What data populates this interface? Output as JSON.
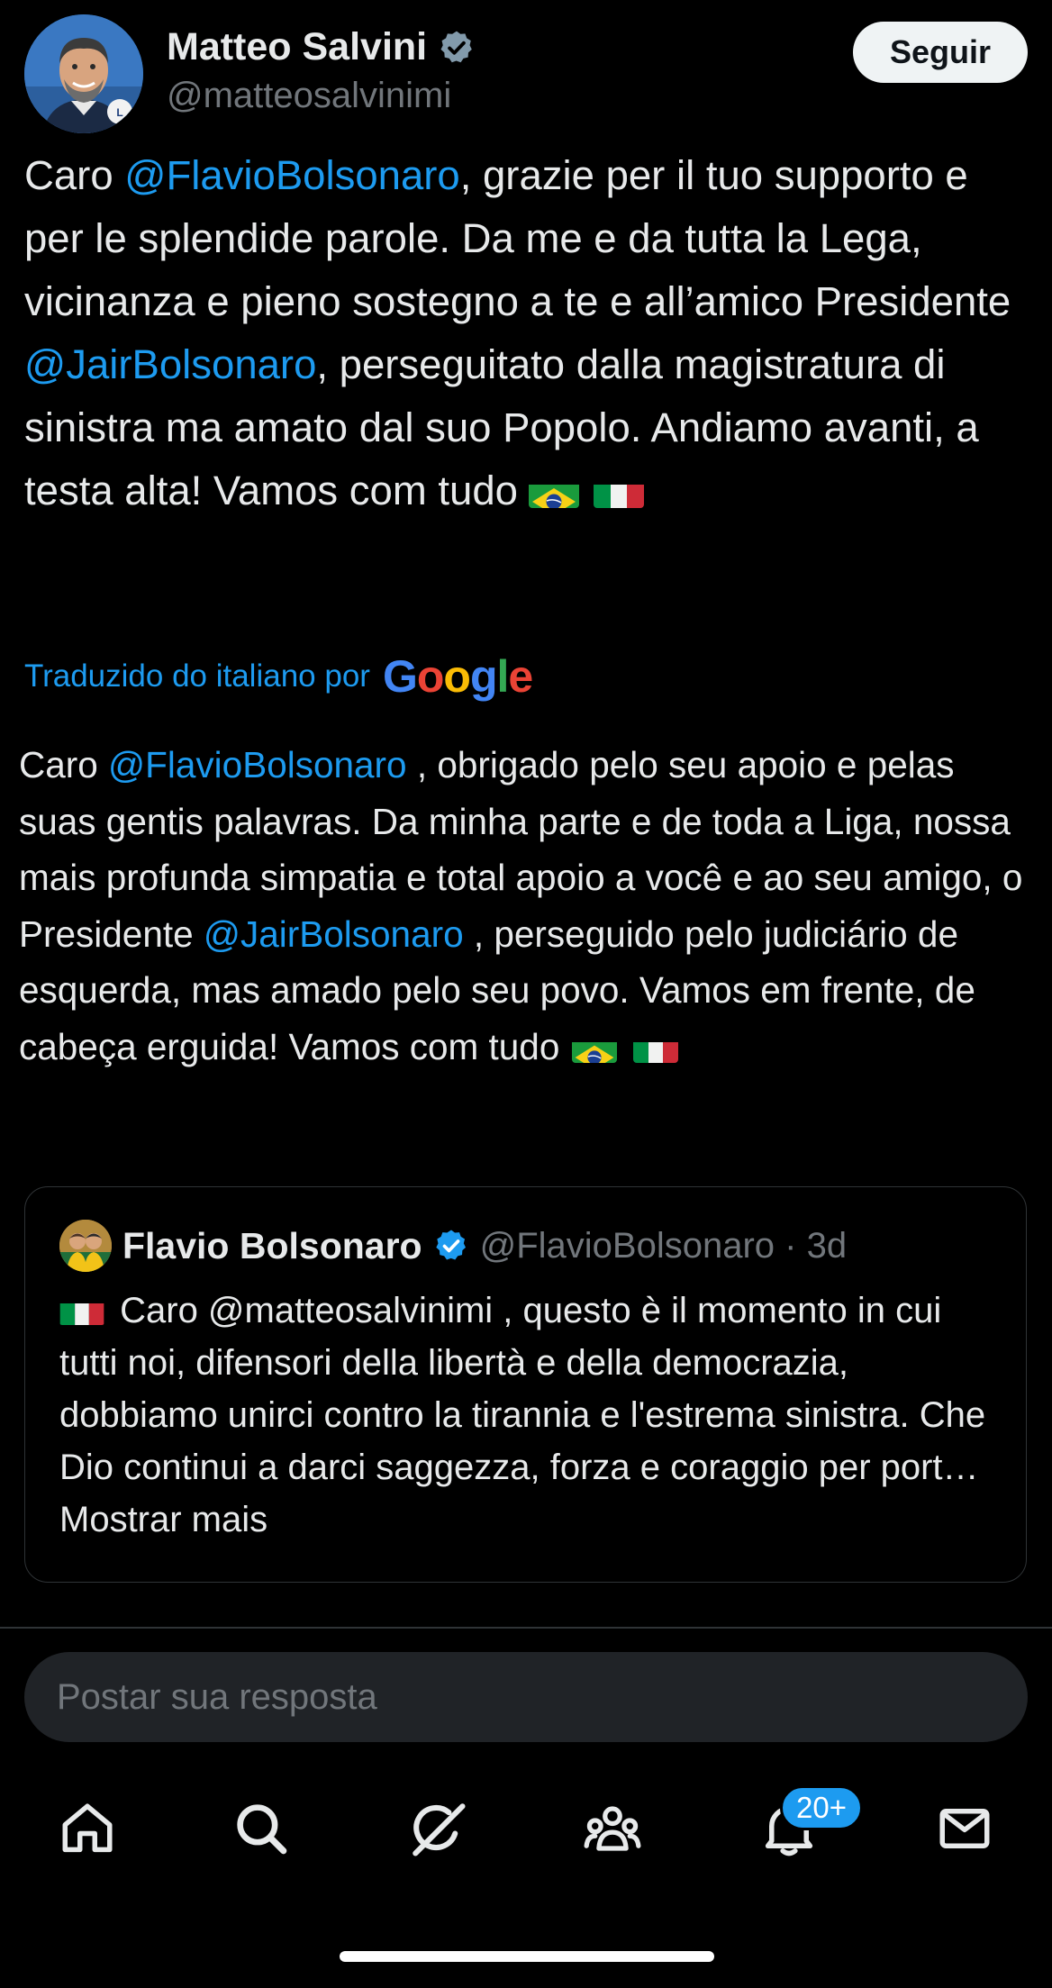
{
  "author": {
    "name": "Matteo Salvini",
    "handle": "@matteosalvinimi",
    "avatar_icon": "person-avatar"
  },
  "follow_button": {
    "label": "Seguir"
  },
  "tweet": {
    "segments": {
      "s1": "Caro ",
      "m1": "@FlavioBolsonaro",
      "s2": ", grazie per il tuo supporto e per le splendide parole. Da me e da tutta la Lega, vicinanza e pieno sostegno a te e all’amico Presidente ",
      "m2": "@JairBolsonaro",
      "s3": ", perseguitato dalla magistratura di sinistra ma amato dal suo Popolo. Andiamo avanti, a testa alta! Vamos com tudo"
    },
    "flags": [
      "brazil-flag",
      "italy-flag"
    ]
  },
  "translation": {
    "label": "Traduzido do italiano por",
    "provider": "Google",
    "segments": {
      "s1": "Caro ",
      "m1": "@FlavioBolsonaro",
      "s2": " , obrigado pelo seu apoio e pelas suas gentis palavras. Da minha parte e de toda a Liga, nossa mais profunda simpatia e total apoio a você e ao seu amigo, o Presidente ",
      "m2": "@JairBolsonaro",
      "s3": " , perseguido pelo judiciário de esquerda, mas amado pelo seu povo. Vamos em frente, de cabeça erguida! Vamos com tudo"
    }
  },
  "quoted_tweet": {
    "name": "Flavio Bolsonaro",
    "handle_time": "@FlavioBolsonaro · 3d",
    "text": " Caro @matteosalvinimi , questo è il momento in cui tutti noi, difensori della libertà e della democrazia, dobbiamo unirci contro la tirannia e l'estrema sinistra. Che Dio continui a darci saggezza, forza e coraggio per port… ",
    "show_more": "Mostrar mais"
  },
  "reply": {
    "placeholder": "Postar sua resposta"
  },
  "nav": {
    "items": [
      "home-icon",
      "search-icon",
      "grok-icon",
      "communities-icon",
      "notifications-icon",
      "messages-icon"
    ],
    "notification_badge": "20+"
  },
  "colors": {
    "accent": "#1d9bf0",
    "background": "#000000",
    "text": "#e7e9ea",
    "muted": "#71767b"
  }
}
